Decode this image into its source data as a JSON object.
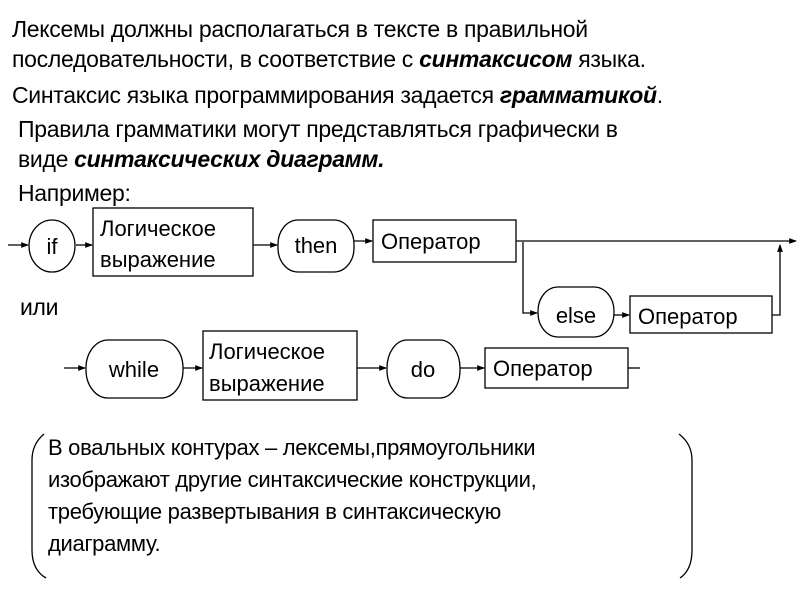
{
  "text": {
    "line1": "Лексемы должны располагаться в тексте в правильной",
    "line2_a": "последовательности, в соответствие с ",
    "line2_b": "синтаксисом",
    "line2_c": " языка.",
    "line3_a": "Синтаксис языка программирования задается ",
    "line3_b": "грамматикой",
    "line3_c": ".",
    "line4": "Правила грамматики могут представляться графически в",
    "line5_a": "виде ",
    "line5_b": "синтаксических диаграмм.",
    "line6": "Например:",
    "or_label": "или"
  },
  "diagram_if": {
    "if_token": "if",
    "condition_line1": "Логическое",
    "condition_line2": "выражение",
    "then_token": "then",
    "statement": "Оператор",
    "else_token": "else",
    "else_statement": "Оператор"
  },
  "diagram_while": {
    "while_token": "while",
    "condition_line1": "Логическое",
    "condition_line2": "выражение",
    "do_token": "do",
    "statement": "Оператор"
  },
  "note": {
    "line1": "В овальных контурах – лексемы,прямоугольники",
    "line2": "изображают другие синтаксические конструкции,",
    "line3": "требующие развертывания в синтаксическую",
    "line4": "диаграмму."
  }
}
